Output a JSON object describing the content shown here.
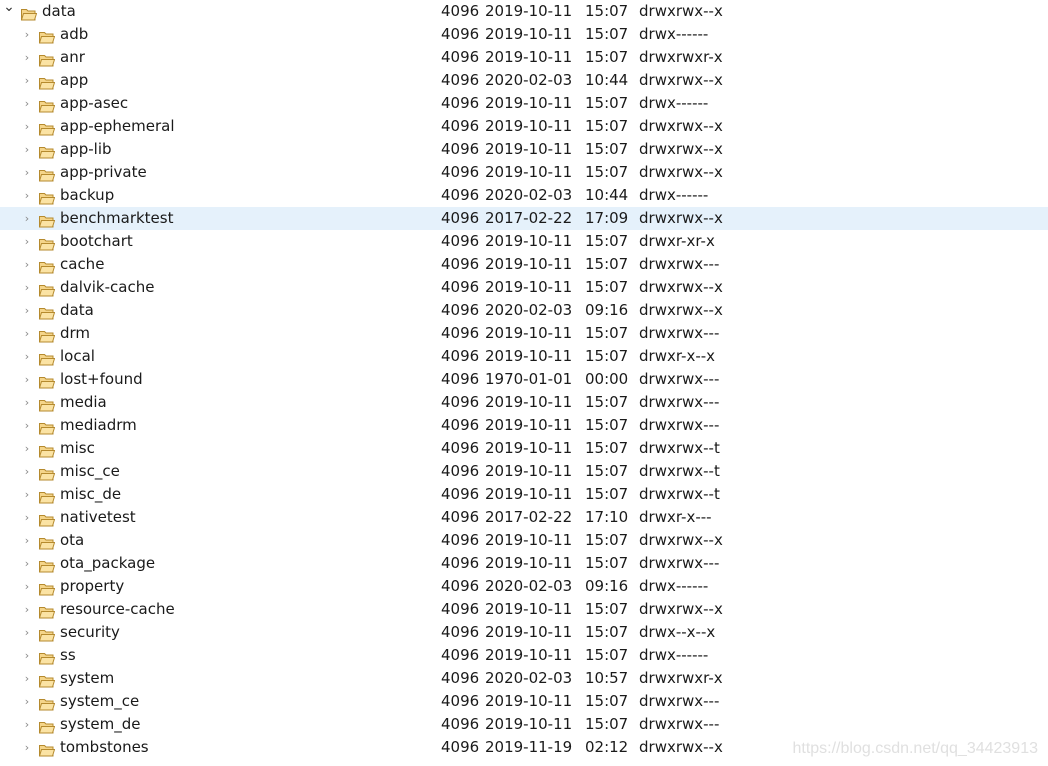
{
  "root": {
    "name": "data",
    "size": "4096",
    "date": "2019-10-11",
    "time": "15:07",
    "perm": "drwxrwx--x",
    "expanded": true
  },
  "selected_index": 8,
  "items": [
    {
      "name": "adb",
      "size": "4096",
      "date": "2019-10-11",
      "time": "15:07",
      "perm": "drwx------"
    },
    {
      "name": "anr",
      "size": "4096",
      "date": "2019-10-11",
      "time": "15:07",
      "perm": "drwxrwxr-x"
    },
    {
      "name": "app",
      "size": "4096",
      "date": "2020-02-03",
      "time": "10:44",
      "perm": "drwxrwx--x"
    },
    {
      "name": "app-asec",
      "size": "4096",
      "date": "2019-10-11",
      "time": "15:07",
      "perm": "drwx------"
    },
    {
      "name": "app-ephemeral",
      "size": "4096",
      "date": "2019-10-11",
      "time": "15:07",
      "perm": "drwxrwx--x"
    },
    {
      "name": "app-lib",
      "size": "4096",
      "date": "2019-10-11",
      "time": "15:07",
      "perm": "drwxrwx--x"
    },
    {
      "name": "app-private",
      "size": "4096",
      "date": "2019-10-11",
      "time": "15:07",
      "perm": "drwxrwx--x"
    },
    {
      "name": "backup",
      "size": "4096",
      "date": "2020-02-03",
      "time": "10:44",
      "perm": "drwx------"
    },
    {
      "name": "benchmarktest",
      "size": "4096",
      "date": "2017-02-22",
      "time": "17:09",
      "perm": "drwxrwx--x"
    },
    {
      "name": "bootchart",
      "size": "4096",
      "date": "2019-10-11",
      "time": "15:07",
      "perm": "drwxr-xr-x"
    },
    {
      "name": "cache",
      "size": "4096",
      "date": "2019-10-11",
      "time": "15:07",
      "perm": "drwxrwx---"
    },
    {
      "name": "dalvik-cache",
      "size": "4096",
      "date": "2019-10-11",
      "time": "15:07",
      "perm": "drwxrwx--x"
    },
    {
      "name": "data",
      "size": "4096",
      "date": "2020-02-03",
      "time": "09:16",
      "perm": "drwxrwx--x"
    },
    {
      "name": "drm",
      "size": "4096",
      "date": "2019-10-11",
      "time": "15:07",
      "perm": "drwxrwx---"
    },
    {
      "name": "local",
      "size": "4096",
      "date": "2019-10-11",
      "time": "15:07",
      "perm": "drwxr-x--x"
    },
    {
      "name": "lost+found",
      "size": "4096",
      "date": "1970-01-01",
      "time": "00:00",
      "perm": "drwxrwx---"
    },
    {
      "name": "media",
      "size": "4096",
      "date": "2019-10-11",
      "time": "15:07",
      "perm": "drwxrwx---"
    },
    {
      "name": "mediadrm",
      "size": "4096",
      "date": "2019-10-11",
      "time": "15:07",
      "perm": "drwxrwx---"
    },
    {
      "name": "misc",
      "size": "4096",
      "date": "2019-10-11",
      "time": "15:07",
      "perm": "drwxrwx--t"
    },
    {
      "name": "misc_ce",
      "size": "4096",
      "date": "2019-10-11",
      "time": "15:07",
      "perm": "drwxrwx--t"
    },
    {
      "name": "misc_de",
      "size": "4096",
      "date": "2019-10-11",
      "time": "15:07",
      "perm": "drwxrwx--t"
    },
    {
      "name": "nativetest",
      "size": "4096",
      "date": "2017-02-22",
      "time": "17:10",
      "perm": "drwxr-x---"
    },
    {
      "name": "ota",
      "size": "4096",
      "date": "2019-10-11",
      "time": "15:07",
      "perm": "drwxrwx--x"
    },
    {
      "name": "ota_package",
      "size": "4096",
      "date": "2019-10-11",
      "time": "15:07",
      "perm": "drwxrwx---"
    },
    {
      "name": "property",
      "size": "4096",
      "date": "2020-02-03",
      "time": "09:16",
      "perm": "drwx------"
    },
    {
      "name": "resource-cache",
      "size": "4096",
      "date": "2019-10-11",
      "time": "15:07",
      "perm": "drwxrwx--x"
    },
    {
      "name": "security",
      "size": "4096",
      "date": "2019-10-11",
      "time": "15:07",
      "perm": "drwx--x--x"
    },
    {
      "name": "ss",
      "size": "4096",
      "date": "2019-10-11",
      "time": "15:07",
      "perm": "drwx------"
    },
    {
      "name": "system",
      "size": "4096",
      "date": "2020-02-03",
      "time": "10:57",
      "perm": "drwxrwxr-x"
    },
    {
      "name": "system_ce",
      "size": "4096",
      "date": "2019-10-11",
      "time": "15:07",
      "perm": "drwxrwx---"
    },
    {
      "name": "system_de",
      "size": "4096",
      "date": "2019-10-11",
      "time": "15:07",
      "perm": "drwxrwx---"
    },
    {
      "name": "tombstones",
      "size": "4096",
      "date": "2019-11-19",
      "time": "02:12",
      "perm": "drwxrwx--x"
    }
  ],
  "watermark": "https://blog.csdn.net/qq_34423913",
  "colors": {
    "selection": "#e5f1fb",
    "folder": "#e8b54e"
  }
}
